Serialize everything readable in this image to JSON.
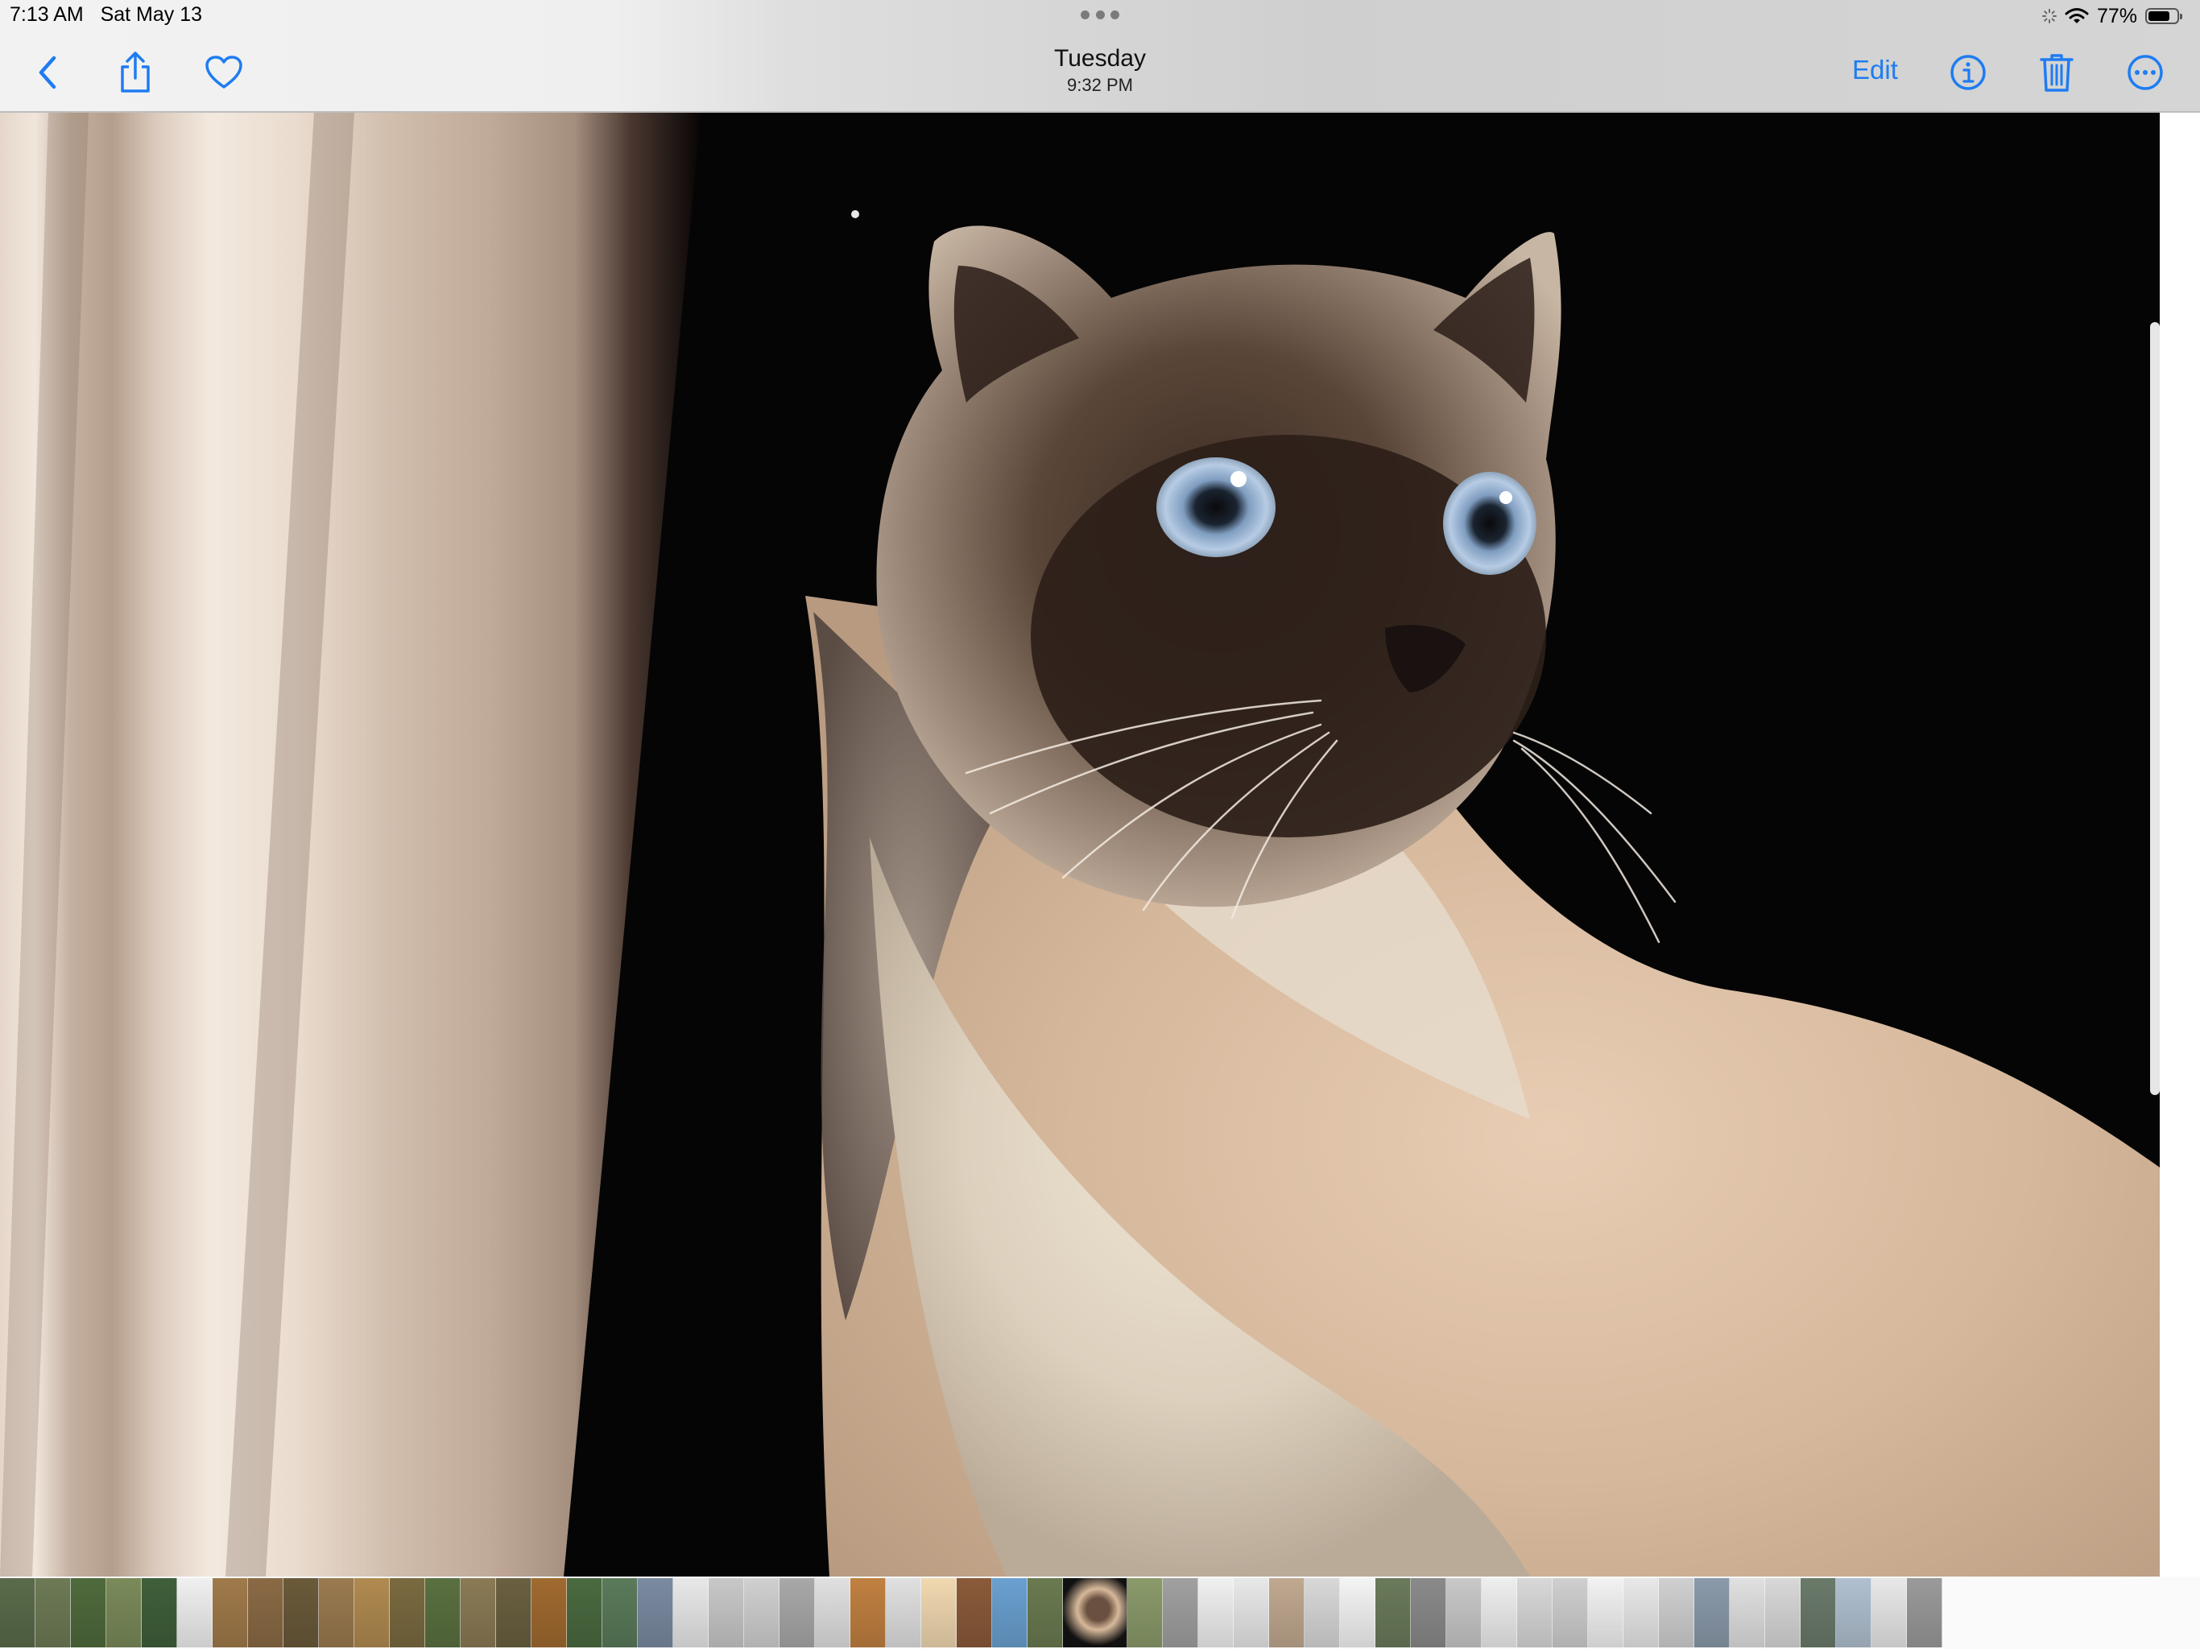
{
  "status_bar": {
    "time": "7:13 AM",
    "date": "Sat May 13",
    "battery_percent": "77%",
    "battery_level": 0.77
  },
  "nav": {
    "title": "Tuesday",
    "subtitle": "9:32 PM",
    "edit_label": "Edit",
    "icons": {
      "back": "chevron-left-icon",
      "share": "share-icon",
      "favorite": "heart-icon",
      "info": "info-icon",
      "delete": "trash-icon",
      "more": "ellipsis-circle-icon"
    }
  },
  "colors": {
    "accent": "#1e7cf2",
    "delete": "#1e7cf2"
  },
  "photo": {
    "subject": "Siamese cat"
  },
  "filmstrip": {
    "thumbnail_colors": [
      "#5a6b4a",
      "#6d7a55",
      "#4f6a3c",
      "#7a8a5a",
      "#3f5f3a",
      "#f0f0f0",
      "#a07a4a",
      "#8a6a45",
      "#6a5a3a",
      "#9a7a50",
      "#b08a50",
      "#7a6a40",
      "#5a7040",
      "#8a7a55",
      "#6a6040",
      "#a06a30",
      "#4a6a40",
      "#5a7a5a",
      "#7a8aa0",
      "#e8e8e8",
      "#c8c8c8",
      "#d0d0d0",
      "#a8a8a8",
      "#e0e0e0",
      "#c08040",
      "#e0e0e0",
      "#f0d8b0",
      "#8a5a3a",
      "#6aa0d0",
      "#6a7a50",
      "#c0a080",
      "#8a9a6a",
      "#a0a0a0",
      "#f0f0f0",
      "#e8e8e8",
      "#c0a890",
      "#d8d8d8",
      "#f4f4f4",
      "#6a7a5a",
      "#8a8a8a",
      "#c8c8c8",
      "#eeeeee",
      "#d8d8d8",
      "#cfcfcf",
      "#f2f2f2",
      "#e8e8e8",
      "#d0d0d0",
      "#8a9aaa",
      "#e0e0e0",
      "#d8d8d8",
      "#6a7a6a",
      "#b0c0d0",
      "#e8e8e8",
      "#9a9a9a"
    ],
    "current_index": 30
  }
}
